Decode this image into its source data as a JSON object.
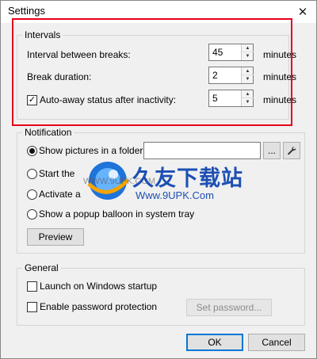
{
  "window": {
    "title": "Settings",
    "close_glyph": "✕"
  },
  "intervals": {
    "legend": "Intervals",
    "break_interval_label": "Interval between breaks:",
    "break_interval_value": "45",
    "break_duration_label": "Break duration:",
    "break_duration_value": "2",
    "auto_away_label": "Auto-away status after inactivity:",
    "auto_away_value": "5",
    "auto_away_checked": true,
    "unit": "minutes"
  },
  "notification": {
    "legend": "Notification",
    "options": [
      {
        "label": "Show pictures in a folder:",
        "selected": true
      },
      {
        "label": "Start the",
        "selected": false
      },
      {
        "label": "Activate a",
        "selected": false
      },
      {
        "label": "Show a popup balloon in system tray",
        "selected": false
      }
    ],
    "browse_label": "...",
    "preview_label": "Preview"
  },
  "general": {
    "legend": "General",
    "launch_startup_label": "Launch on Windows startup",
    "password_protection_label": "Enable password protection",
    "set_password_label": "Set password..."
  },
  "footer": {
    "ok_label": "OK",
    "cancel_label": "Cancel"
  },
  "watermark": {
    "title": "久友下载站",
    "url": "Www.9UPK.Com",
    "sub": "WWW.9UPK.COM"
  },
  "icons": {
    "spin_up": "▲",
    "spin_down": "▼",
    "checkmark": "✓"
  },
  "colors": {
    "highlight": "#e6001a",
    "accent": "#0078d7",
    "watermark_blue": "#1d4fb3"
  }
}
